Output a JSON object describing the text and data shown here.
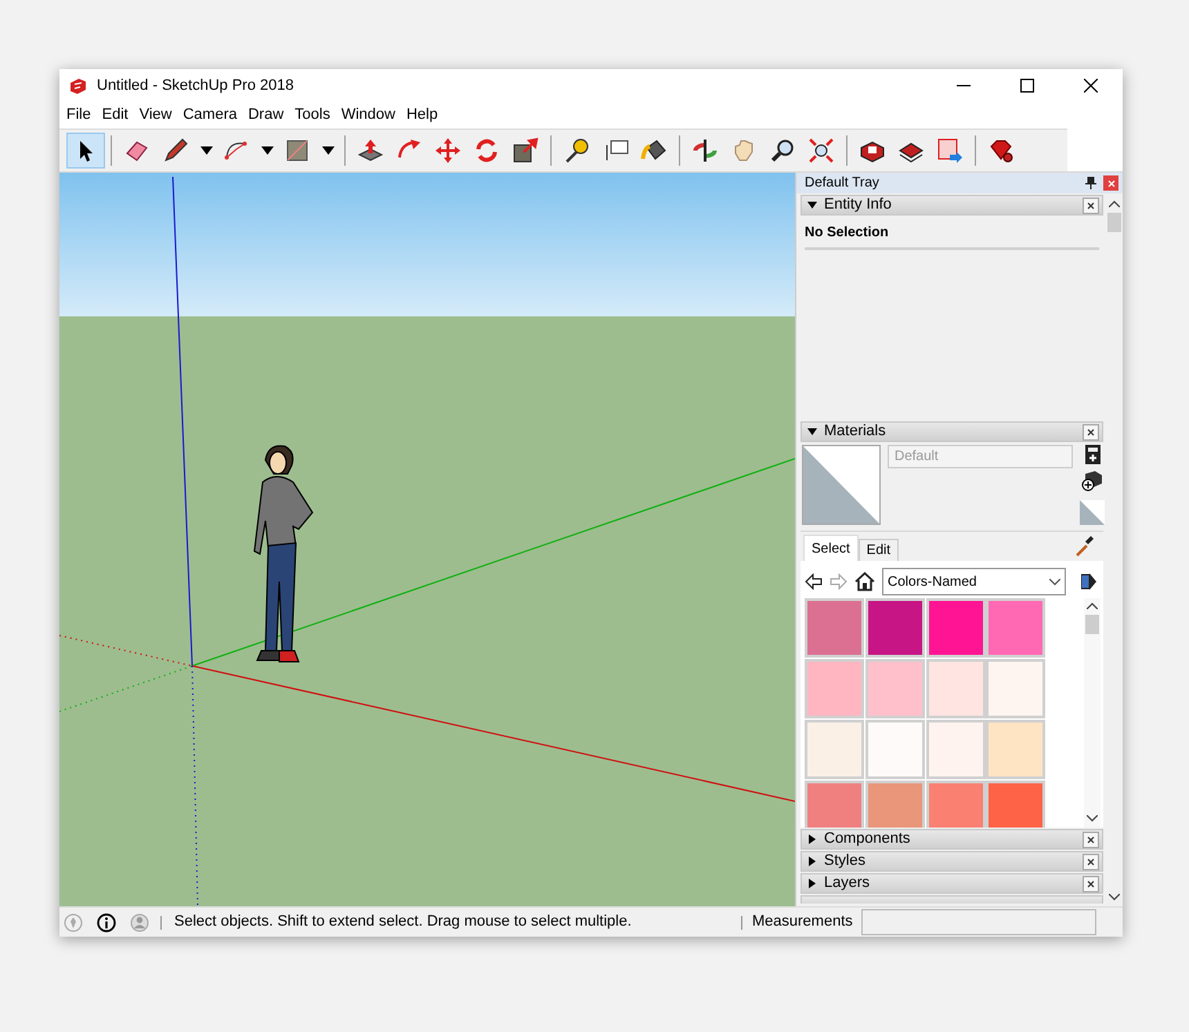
{
  "window": {
    "title": "Untitled - SketchUp Pro 2018"
  },
  "menu": [
    "File",
    "Edit",
    "View",
    "Camera",
    "Draw",
    "Tools",
    "Window",
    "Help"
  ],
  "toolbar": [
    {
      "kind": "select",
      "selected": true,
      "has_menu": false
    },
    {
      "kind": "separator"
    },
    {
      "kind": "eraser",
      "selected": false,
      "has_menu": false
    },
    {
      "kind": "pencil",
      "selected": false,
      "has_menu": true
    },
    {
      "kind": "arc",
      "selected": false,
      "has_menu": true
    },
    {
      "kind": "rectangle",
      "selected": false,
      "has_menu": true
    },
    {
      "kind": "separator"
    },
    {
      "kind": "pushpull",
      "selected": false,
      "has_menu": false
    },
    {
      "kind": "followme",
      "selected": false,
      "has_menu": false
    },
    {
      "kind": "move",
      "selected": false,
      "has_menu": false
    },
    {
      "kind": "rotate",
      "selected": false,
      "has_menu": false
    },
    {
      "kind": "scale",
      "selected": false,
      "has_menu": false
    },
    {
      "kind": "separator"
    },
    {
      "kind": "tape",
      "selected": false,
      "has_menu": false
    },
    {
      "kind": "text",
      "selected": false,
      "has_menu": false
    },
    {
      "kind": "paint",
      "selected": false,
      "has_menu": false
    },
    {
      "kind": "separator"
    },
    {
      "kind": "orbit",
      "selected": false,
      "has_menu": false
    },
    {
      "kind": "pan",
      "selected": false,
      "has_menu": false
    },
    {
      "kind": "zoom",
      "selected": false,
      "has_menu": false
    },
    {
      "kind": "zoomext",
      "selected": false,
      "has_menu": false
    },
    {
      "kind": "separator"
    },
    {
      "kind": "cube",
      "selected": false,
      "has_menu": false
    },
    {
      "kind": "stack",
      "selected": false,
      "has_menu": false
    },
    {
      "kind": "map",
      "selected": false,
      "has_menu": false
    },
    {
      "kind": "separator"
    },
    {
      "kind": "gem",
      "selected": false,
      "has_menu": false
    }
  ],
  "tray": {
    "title": "Default Tray",
    "panels": [
      {
        "kind": "entity_info",
        "title": "Entity Info",
        "expanded": true,
        "selection": "No Selection"
      },
      {
        "kind": "materials",
        "title": "Materials",
        "expanded": true,
        "placeholder": "Default",
        "tabs": [
          {
            "label": "Select",
            "selected": true
          },
          {
            "label": "Edit",
            "selected": false
          }
        ],
        "library": "Colors-Named",
        "swatches": [
          {
            "color": "#db7093"
          },
          {
            "color": "#c71585"
          },
          {
            "color": "#ff1493"
          },
          {
            "color": "#ff69b4"
          },
          {
            "color": "#ffb6c1"
          },
          {
            "color": "#ffc0cb"
          },
          {
            "color": "#ffe4e1"
          },
          {
            "color": "#fff5f0"
          },
          {
            "color": "#faf0e6"
          },
          {
            "color": "#fffafa"
          },
          {
            "color": "#fff3ef"
          },
          {
            "color": "#ffe4c4"
          },
          {
            "color": "#f08080"
          },
          {
            "color": "#e9967a"
          },
          {
            "color": "#fa8072"
          },
          {
            "color": "#ff6347"
          }
        ]
      },
      {
        "kind": "collapsed",
        "title": "Components",
        "expanded": false
      },
      {
        "kind": "collapsed",
        "title": "Styles",
        "expanded": false
      },
      {
        "kind": "collapsed",
        "title": "Layers",
        "expanded": false
      }
    ]
  },
  "status_bar": {
    "message": "Select objects. Shift to extend select. Drag mouse to select multiple.",
    "measurements_label": "Measurements"
  }
}
